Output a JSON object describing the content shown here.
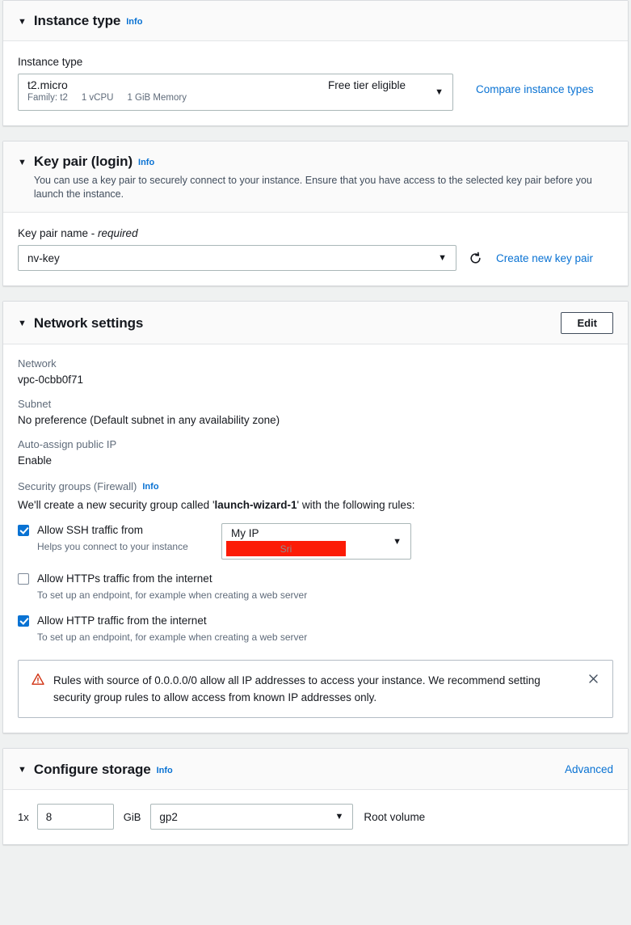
{
  "instance_type_section": {
    "title": "Instance type",
    "info_label": "Info",
    "caret": "▼",
    "field_label": "Instance type",
    "selected_name": "t2.micro",
    "tier_badge": "Free tier eligible",
    "meta": [
      "Family: t2",
      "1 vCPU",
      "1 GiB Memory"
    ],
    "compare_link": "Compare instance types"
  },
  "key_pair_section": {
    "title": "Key pair (login)",
    "info_label": "Info",
    "caret": "▼",
    "description": "You can use a key pair to securely connect to your instance. Ensure that you have access to the selected key pair before you launch the instance.",
    "field_label_main": "Key pair name - ",
    "field_label_req": "required",
    "selected_key": "nv-key",
    "create_link": "Create new key pair"
  },
  "network_section": {
    "title": "Network settings",
    "caret": "▼",
    "edit_button": "Edit",
    "fields": [
      {
        "label": "Network",
        "value": "vpc-0cbb0f71"
      },
      {
        "label": "Subnet",
        "value": "No preference (Default subnet in any availability zone)"
      },
      {
        "label": "Auto-assign public IP",
        "value": "Enable"
      }
    ],
    "security_groups_label": "Security groups (Firewall)",
    "security_groups_info": "Info",
    "sg_sentence_pre": "We'll create a new security group called '",
    "sg_name": "launch-wizard-1",
    "sg_sentence_post": "' with the following rules:",
    "rules": [
      {
        "checked": true,
        "title": "Allow SSH traffic from",
        "sub": "Helps you connect to your instance",
        "has_source_select": true,
        "source_value": "My IP",
        "redacted_text": "Sri"
      },
      {
        "checked": false,
        "title": "Allow HTTPs traffic from the internet",
        "sub": "To set up an endpoint, for example when creating a web server",
        "has_source_select": false
      },
      {
        "checked": true,
        "title": "Allow HTTP traffic from the internet",
        "sub": "To set up an endpoint, for example when creating a web server",
        "has_source_select": false
      }
    ],
    "alert": {
      "text": "Rules with source of 0.0.0.0/0 allow all IP addresses to access your instance. We recommend setting security group rules to allow access from known IP addresses only.",
      "icon": "warning-triangle-icon",
      "close_icon": "close-icon"
    }
  },
  "storage_section": {
    "title": "Configure storage",
    "info_label": "Info",
    "caret": "▼",
    "advanced_link": "Advanced",
    "multiplier": "1x",
    "size_value": "8",
    "unit": "GiB",
    "volume_type": "gp2",
    "root_label": "Root volume"
  },
  "colors": {
    "link": "#0972d3",
    "checkbox_on": "#0972d3",
    "redaction": "#fc1b06",
    "warning": "#d13212",
    "page_bg": "#eff1f1",
    "panel_head_bg": "#fafafa",
    "border": "#d9dcdf"
  },
  "icons": {
    "dropdown_caret": "▼",
    "section_caret": "▼",
    "close": "×"
  }
}
